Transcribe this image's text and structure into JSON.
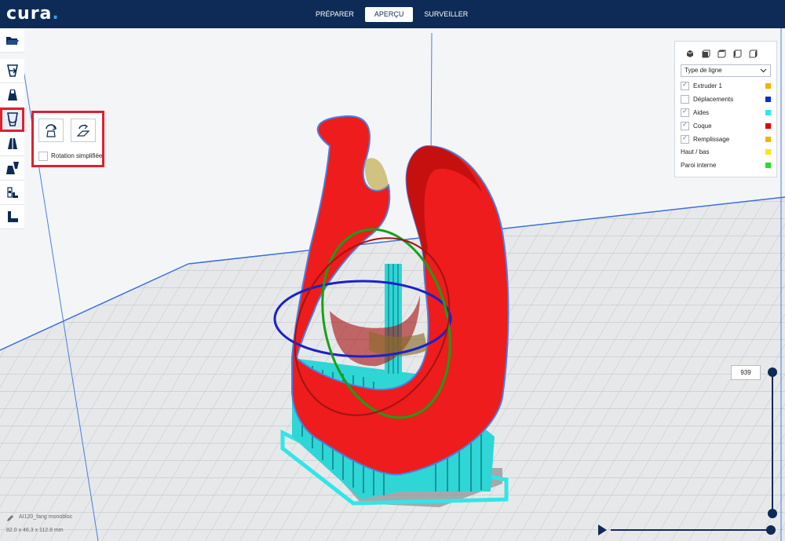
{
  "app": {
    "logo": "cura",
    "logo_dot": "."
  },
  "stages": [
    {
      "label": "PRÉPARER",
      "active": false
    },
    {
      "label": "APERÇU",
      "active": true
    },
    {
      "label": "SURVEILLER",
      "active": false
    }
  ],
  "toolbar": {
    "items": [
      "open-file-icon",
      "move-icon",
      "scale-icon",
      "rotate-icon",
      "mirror-icon",
      "per-model-settings-icon",
      "support-blocker-icon",
      "layflat-icon"
    ]
  },
  "rotate_panel": {
    "reset_icon": "rotate-reset-icon",
    "lay_flat_icon": "lay-flat-icon",
    "checkbox_label": "Rotation simplifiée"
  },
  "legend": {
    "view_icons": [
      "3d-view-icon",
      "front-view-icon",
      "top-view-icon",
      "left-view-icon",
      "right-view-icon"
    ],
    "line_type": "Type de ligne",
    "items": [
      {
        "label": "Extruder 1",
        "checked": true,
        "color": "#f0b400"
      },
      {
        "label": "Déplacements",
        "checked": false,
        "color": "#0a2bd6"
      },
      {
        "label": "Aides",
        "checked": true,
        "color": "#32e6e6"
      },
      {
        "label": "Coque",
        "checked": true,
        "color": "#e00000"
      },
      {
        "label": "Remplissage",
        "checked": true,
        "color": "#f0b400"
      },
      {
        "label": "Haut / bas",
        "checked": null,
        "color": "#ffe41c"
      },
      {
        "label": "Paroi interne",
        "checked": null,
        "color": "#2adc2a"
      }
    ]
  },
  "layer": {
    "value": "939"
  },
  "object": {
    "name": "AI120_fang monobloc",
    "dims": "82.0 x 46.3 x 112.8 mm"
  },
  "colors": {
    "header": "#0d2b56",
    "shell": "#e00000",
    "support": "#32e6e6",
    "selection": "#e0202c"
  }
}
